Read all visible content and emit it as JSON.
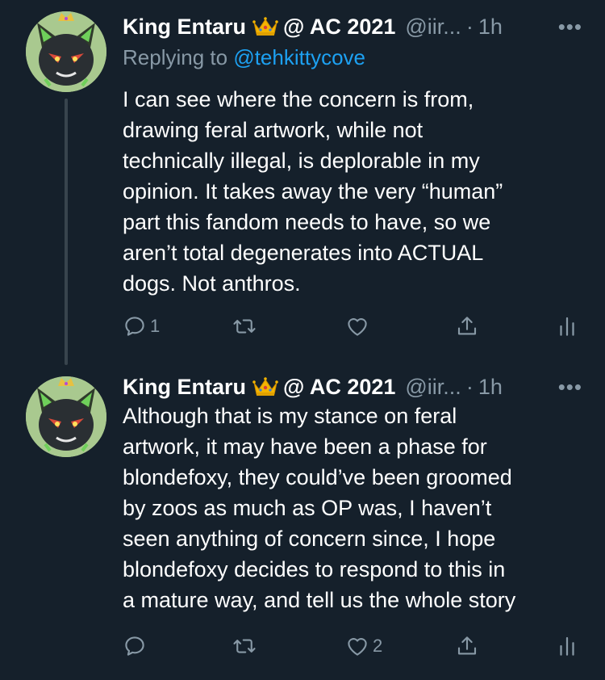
{
  "colors": {
    "background": "#15202b",
    "text_primary": "#ffffff",
    "text_secondary": "#8899a6",
    "link": "#1da1f2",
    "thread_line": "#38444d"
  },
  "tweets": [
    {
      "author_name": "King Entaru",
      "author_badge_icon": "crown-emoji",
      "author_name_suffix": "@ AC 2021",
      "handle": "@iir...",
      "separator": "·",
      "time": "1h",
      "more_label": "•••",
      "replying_label": "Replying to",
      "replying_to": "@tehkittycove",
      "body_lines": [
        "I can see where the concern is from,",
        "drawing feral artwork, while not",
        "technically illegal, is deplorable in my",
        "opinion. It takes away the very “human”",
        "part this fandom needs to have, so we",
        "aren’t total degenerates into ACTUAL",
        "dogs. Not anthros."
      ],
      "actions": {
        "reply_icon": "reply-icon",
        "reply_count": "1",
        "retweet_icon": "retweet-icon",
        "retweet_count": "",
        "like_icon": "heart-icon",
        "like_count": "",
        "share_icon": "share-icon",
        "analytics_icon": "analytics-icon"
      }
    },
    {
      "author_name": "King Entaru",
      "author_badge_icon": "crown-emoji",
      "author_name_suffix": "@ AC 2021",
      "handle": "@iir...",
      "separator": "·",
      "time": "1h",
      "more_label": "•••",
      "body_lines": [
        "Although that is my stance on feral",
        "artwork, it may have been a phase for",
        "blondefoxy, they could’ve been groomed",
        "by zoos as much as OP was, I haven’t",
        "seen anything of concern since, I hope",
        "blondefoxy decides to respond to this in",
        "a mature way, and tell us the whole story"
      ],
      "actions": {
        "reply_icon": "reply-icon",
        "reply_count": "",
        "retweet_icon": "retweet-icon",
        "retweet_count": "",
        "like_icon": "heart-icon",
        "like_count": "2",
        "share_icon": "share-icon",
        "analytics_icon": "analytics-icon"
      }
    }
  ]
}
